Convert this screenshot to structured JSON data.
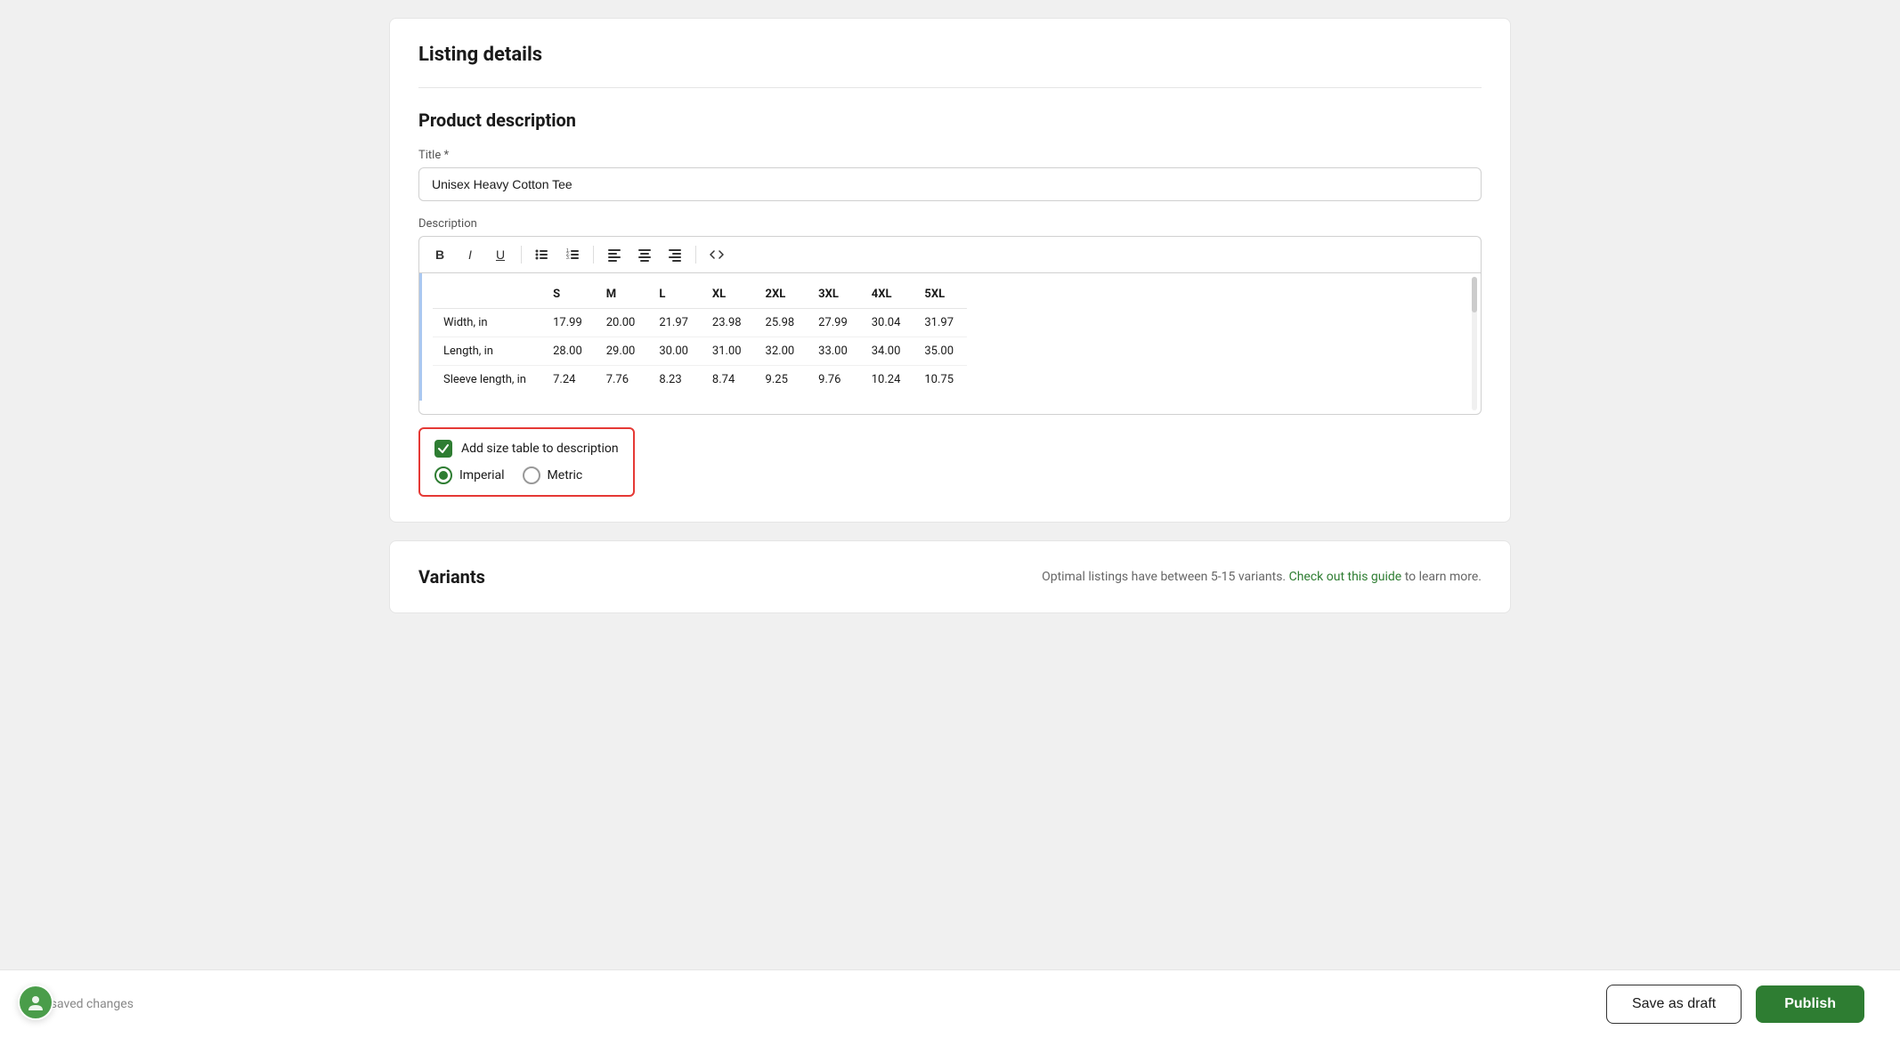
{
  "page": {
    "listing_details_title": "Listing details",
    "product_description_title": "Product description",
    "title_label": "Title *",
    "title_value": "Unisex Heavy Cotton Tee",
    "description_label": "Description",
    "toolbar": {
      "bold": "B",
      "italic": "I",
      "underline": "U",
      "ul": "≡",
      "ol": "≡",
      "align_left": "≡",
      "align_center": "≡",
      "align_right": "≡",
      "code": "<>"
    },
    "size_table": {
      "headers": [
        "",
        "S",
        "M",
        "L",
        "XL",
        "2XL",
        "3XL",
        "4XL",
        "5XL"
      ],
      "rows": [
        {
          "label": "Width, in",
          "values": [
            "17.99",
            "20.00",
            "21.97",
            "23.98",
            "25.98",
            "27.99",
            "30.04",
            "31.97"
          ]
        },
        {
          "label": "Length, in",
          "values": [
            "28.00",
            "29.00",
            "30.00",
            "31.00",
            "32.00",
            "33.00",
            "34.00",
            "35.00"
          ]
        },
        {
          "label": "Sleeve length, in",
          "values": [
            "7.24",
            "7.76",
            "8.23",
            "8.74",
            "9.25",
            "9.76",
            "10.24",
            "10.75"
          ]
        }
      ]
    },
    "add_size_table_label": "Add size table to description",
    "imperial_label": "Imperial",
    "metric_label": "Metric",
    "variants_title": "Variants",
    "variants_hint": "Optimal listings have between 5-15 variants.",
    "variants_hint_link": "Check out this guide",
    "variants_hint_suffix": "to learn more.",
    "unsaved_text": "Unsaved changes",
    "save_draft_label": "Save as draft",
    "publish_label": "Publish"
  },
  "colors": {
    "green": "#2e7d32",
    "red_border": "#e53935",
    "blue_left_border": "#aac8f0"
  }
}
